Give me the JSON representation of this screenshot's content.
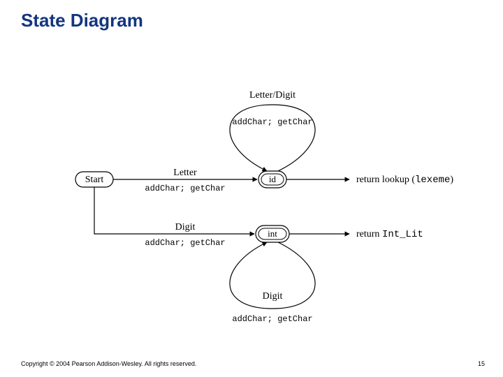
{
  "slide": {
    "title": "State Diagram",
    "copyright": "Copyright © 2004 Pearson Addison-Wesley. All rights reserved.",
    "page_number": "15"
  },
  "diagram": {
    "nodes": {
      "start": "Start",
      "id": "id",
      "int": "int"
    },
    "edges": {
      "start_to_id": {
        "label_top": "Letter",
        "label_bottom": "addChar; getChar"
      },
      "start_to_int": {
        "label_top": "Digit",
        "label_bottom": "addChar; getChar"
      },
      "id_loop": {
        "label_top": "Letter/Digit",
        "label_bottom": "addChar; getChar"
      },
      "int_loop": {
        "label_top": "Digit",
        "label_bottom": "addChar; getChar"
      },
      "id_exit_pre": "return lookup (",
      "id_exit_arg": "lexeme",
      "id_exit_post": ")",
      "int_exit_pre": "return ",
      "int_exit_code": "Int_Lit"
    }
  }
}
